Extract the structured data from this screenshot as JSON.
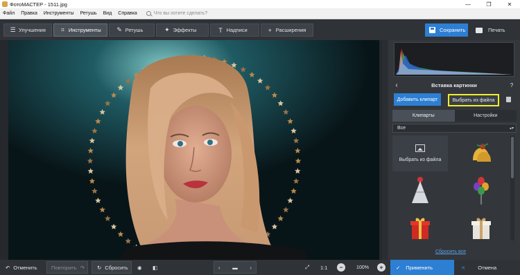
{
  "window": {
    "title": "ФотоМАСТЕР - 1511.jpg",
    "controls": [
      "—",
      "❐",
      "✕"
    ]
  },
  "menu": {
    "items": [
      "Файл",
      "Правка",
      "Инструменты",
      "Ретушь",
      "Вид",
      "Справка"
    ],
    "search_placeholder": "Что вы хотите сделать?"
  },
  "tabs": [
    {
      "label": "Улучшения",
      "icon": "sliders-icon"
    },
    {
      "label": "Инструменты",
      "icon": "crop-icon",
      "active": true
    },
    {
      "label": "Ретушь",
      "icon": "brush-icon"
    },
    {
      "label": "Эффекты",
      "icon": "magic-wand-icon"
    },
    {
      "label": "Надписи",
      "icon": "text-icon"
    },
    {
      "label": "Расширения",
      "icon": "plus-icon"
    }
  ],
  "toolbar": {
    "save_label": "Сохранить",
    "print_label": "Печать"
  },
  "panel": {
    "title": "Вставка картинки",
    "help": "?",
    "add_clipart": "Добавить клипарт",
    "choose_file": "Выбрать из файла",
    "subtabs": [
      "Клипарты",
      "Настройки"
    ],
    "category": "Все",
    "file_tile_label": "Выбрать из файла",
    "cliparts": [
      "bells-clipart",
      "party-hat-clipart",
      "balloons-clipart",
      "gift-red-clipart",
      "gift-white-clipart"
    ],
    "reset_all": "Сбросить все"
  },
  "bottom": {
    "undo": "Отменить",
    "redo": "Повторить",
    "reset": "Сбросить",
    "fit": "1:1",
    "zoom": "100%",
    "apply": "Применить",
    "cancel": "Отмена"
  },
  "colors": {
    "accent": "#2d7fd4",
    "highlight": "#f2ef2b",
    "link": "#5aa2ea"
  }
}
